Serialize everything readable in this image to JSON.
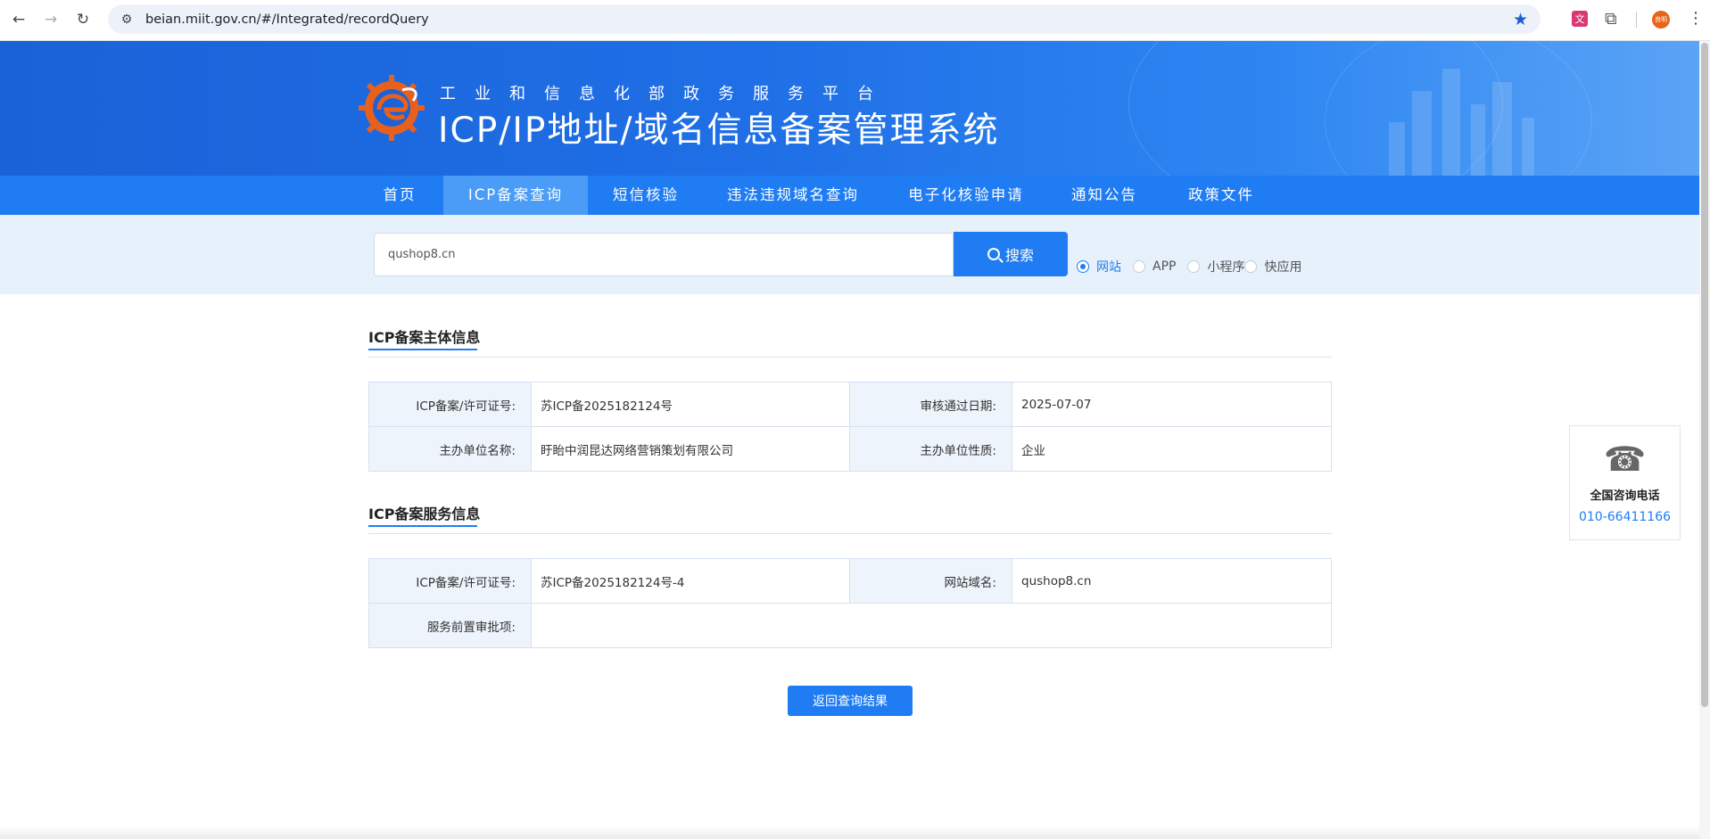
{
  "browser": {
    "url": "beian.miit.gov.cn/#/Integrated/recordQuery",
    "back_icon": "arrow-left",
    "forward_icon": "arrow-right",
    "reload_icon": "reload",
    "avatar_text": "良明"
  },
  "header": {
    "subtitle": "工业和信息化部政务服务平台",
    "title": "ICP/IP地址/域名信息备案管理系统"
  },
  "nav": {
    "items": [
      {
        "label": "首页"
      },
      {
        "label": "ICP备案查询"
      },
      {
        "label": "短信核验"
      },
      {
        "label": "违法违规域名查询"
      },
      {
        "label": "电子化核验申请"
      },
      {
        "label": "通知公告"
      },
      {
        "label": "政策文件"
      }
    ],
    "active": "ICP备案查询"
  },
  "search": {
    "value": "qushop8.cn",
    "button_label": "搜索",
    "options": [
      {
        "label": "网站",
        "checked": true
      },
      {
        "label": "APP",
        "checked": false
      },
      {
        "label": "小程序",
        "checked": false
      },
      {
        "label": "快应用",
        "checked": false
      }
    ]
  },
  "subject_section": {
    "title": "ICP备案主体信息",
    "rows": [
      {
        "l1": "ICP备案/许可证号:",
        "v1": "苏ICP备2025182124号",
        "l2": "审核通过日期:",
        "v2": "2025-07-07"
      },
      {
        "l1": "主办单位名称:",
        "v1": "盱眙中润昆达网络营销策划有限公司",
        "l2": "主办单位性质:",
        "v2": "企业"
      }
    ]
  },
  "service_section": {
    "title": "ICP备案服务信息",
    "row1": {
      "l1": "ICP备案/许可证号:",
      "v1": "苏ICP备2025182124号-4",
      "l2": "网站域名:",
      "v2": "qushop8.cn"
    },
    "row2": {
      "l1": "服务前置审批项:",
      "v1": ""
    }
  },
  "back_button": "返回查询结果",
  "contact": {
    "label": "全国咨询电话",
    "number": "010-66411166"
  },
  "colors": {
    "primary": "#1f7cf3",
    "banner": "#1a62d8"
  }
}
